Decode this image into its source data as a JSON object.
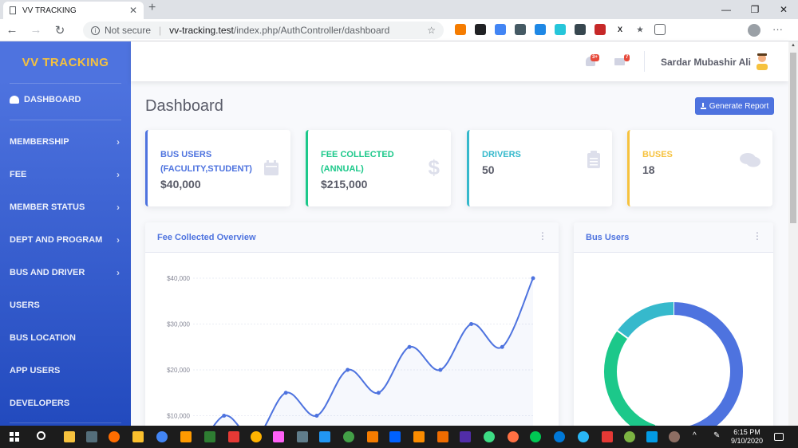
{
  "browser": {
    "tab_title": "VV TRACKING",
    "tab_close": "✕",
    "new_tab": "+",
    "not_secure": "Not secure",
    "url_host": "vv-tracking.test",
    "url_path": "/index.php/AuthController/dashboard",
    "win_min": "—",
    "win_max": "❐",
    "win_close": "✕"
  },
  "sidebar": {
    "brand": "VV TRACKING",
    "items": [
      {
        "label": "DASHBOARD",
        "active": true
      },
      {
        "label": "MEMBERSHIP",
        "chevron": "›"
      },
      {
        "label": "FEE",
        "chevron": "›"
      },
      {
        "label": "MEMBER STATUS",
        "chevron": "›"
      },
      {
        "label": "DEPT AND PROGRAM",
        "chevron": "›"
      },
      {
        "label": "BUS AND DRIVER",
        "chevron": "›"
      },
      {
        "label": "USERS"
      },
      {
        "label": "BUS LOCATION"
      },
      {
        "label": "APP USERS"
      },
      {
        "label": "DEVELOPERS"
      }
    ]
  },
  "topbar": {
    "alerts_badge": "3+",
    "messages_badge": "7",
    "user_name": "Sardar Mubashir Ali"
  },
  "page": {
    "title": "Dashboard",
    "generate_report": "Generate Report"
  },
  "cards": [
    {
      "label": "BUS USERS (FACULITY,STUDENT)",
      "value": "$40,000",
      "color": "#4e73df",
      "icon": "calendar-icon"
    },
    {
      "label": "FEE COLLECTED (ANNUAL)",
      "value": "$215,000",
      "color": "#1cc88a",
      "icon": "dollar-icon"
    },
    {
      "label": "DRIVERS",
      "value": "50",
      "color": "#36b9cc",
      "icon": "clipboard-icon"
    },
    {
      "label": "BUSES",
      "value": "18",
      "color": "#f6c23e",
      "icon": "comments-icon"
    }
  ],
  "panels": {
    "area_title": "Fee Collected Overview",
    "pie_title": "Bus Users"
  },
  "chart_data": [
    {
      "type": "line",
      "title": "Fee Collected Overview",
      "y_ticks": [
        "$10,000",
        "$20,000",
        "$30,000",
        "$40,000"
      ],
      "values": [
        0,
        10000,
        5000,
        15000,
        10000,
        20000,
        15000,
        25000,
        20000,
        30000,
        25000,
        40000
      ],
      "ylim": [
        0,
        40000
      ],
      "grid": true,
      "color": "#4e73df"
    },
    {
      "type": "pie",
      "title": "Bus Users",
      "values": [
        55,
        30,
        15
      ],
      "colors": [
        "#4e73df",
        "#1cc88a",
        "#36b9cc"
      ]
    }
  ],
  "taskbar": {
    "time": "6:15 PM",
    "date": "9/10/2020"
  }
}
